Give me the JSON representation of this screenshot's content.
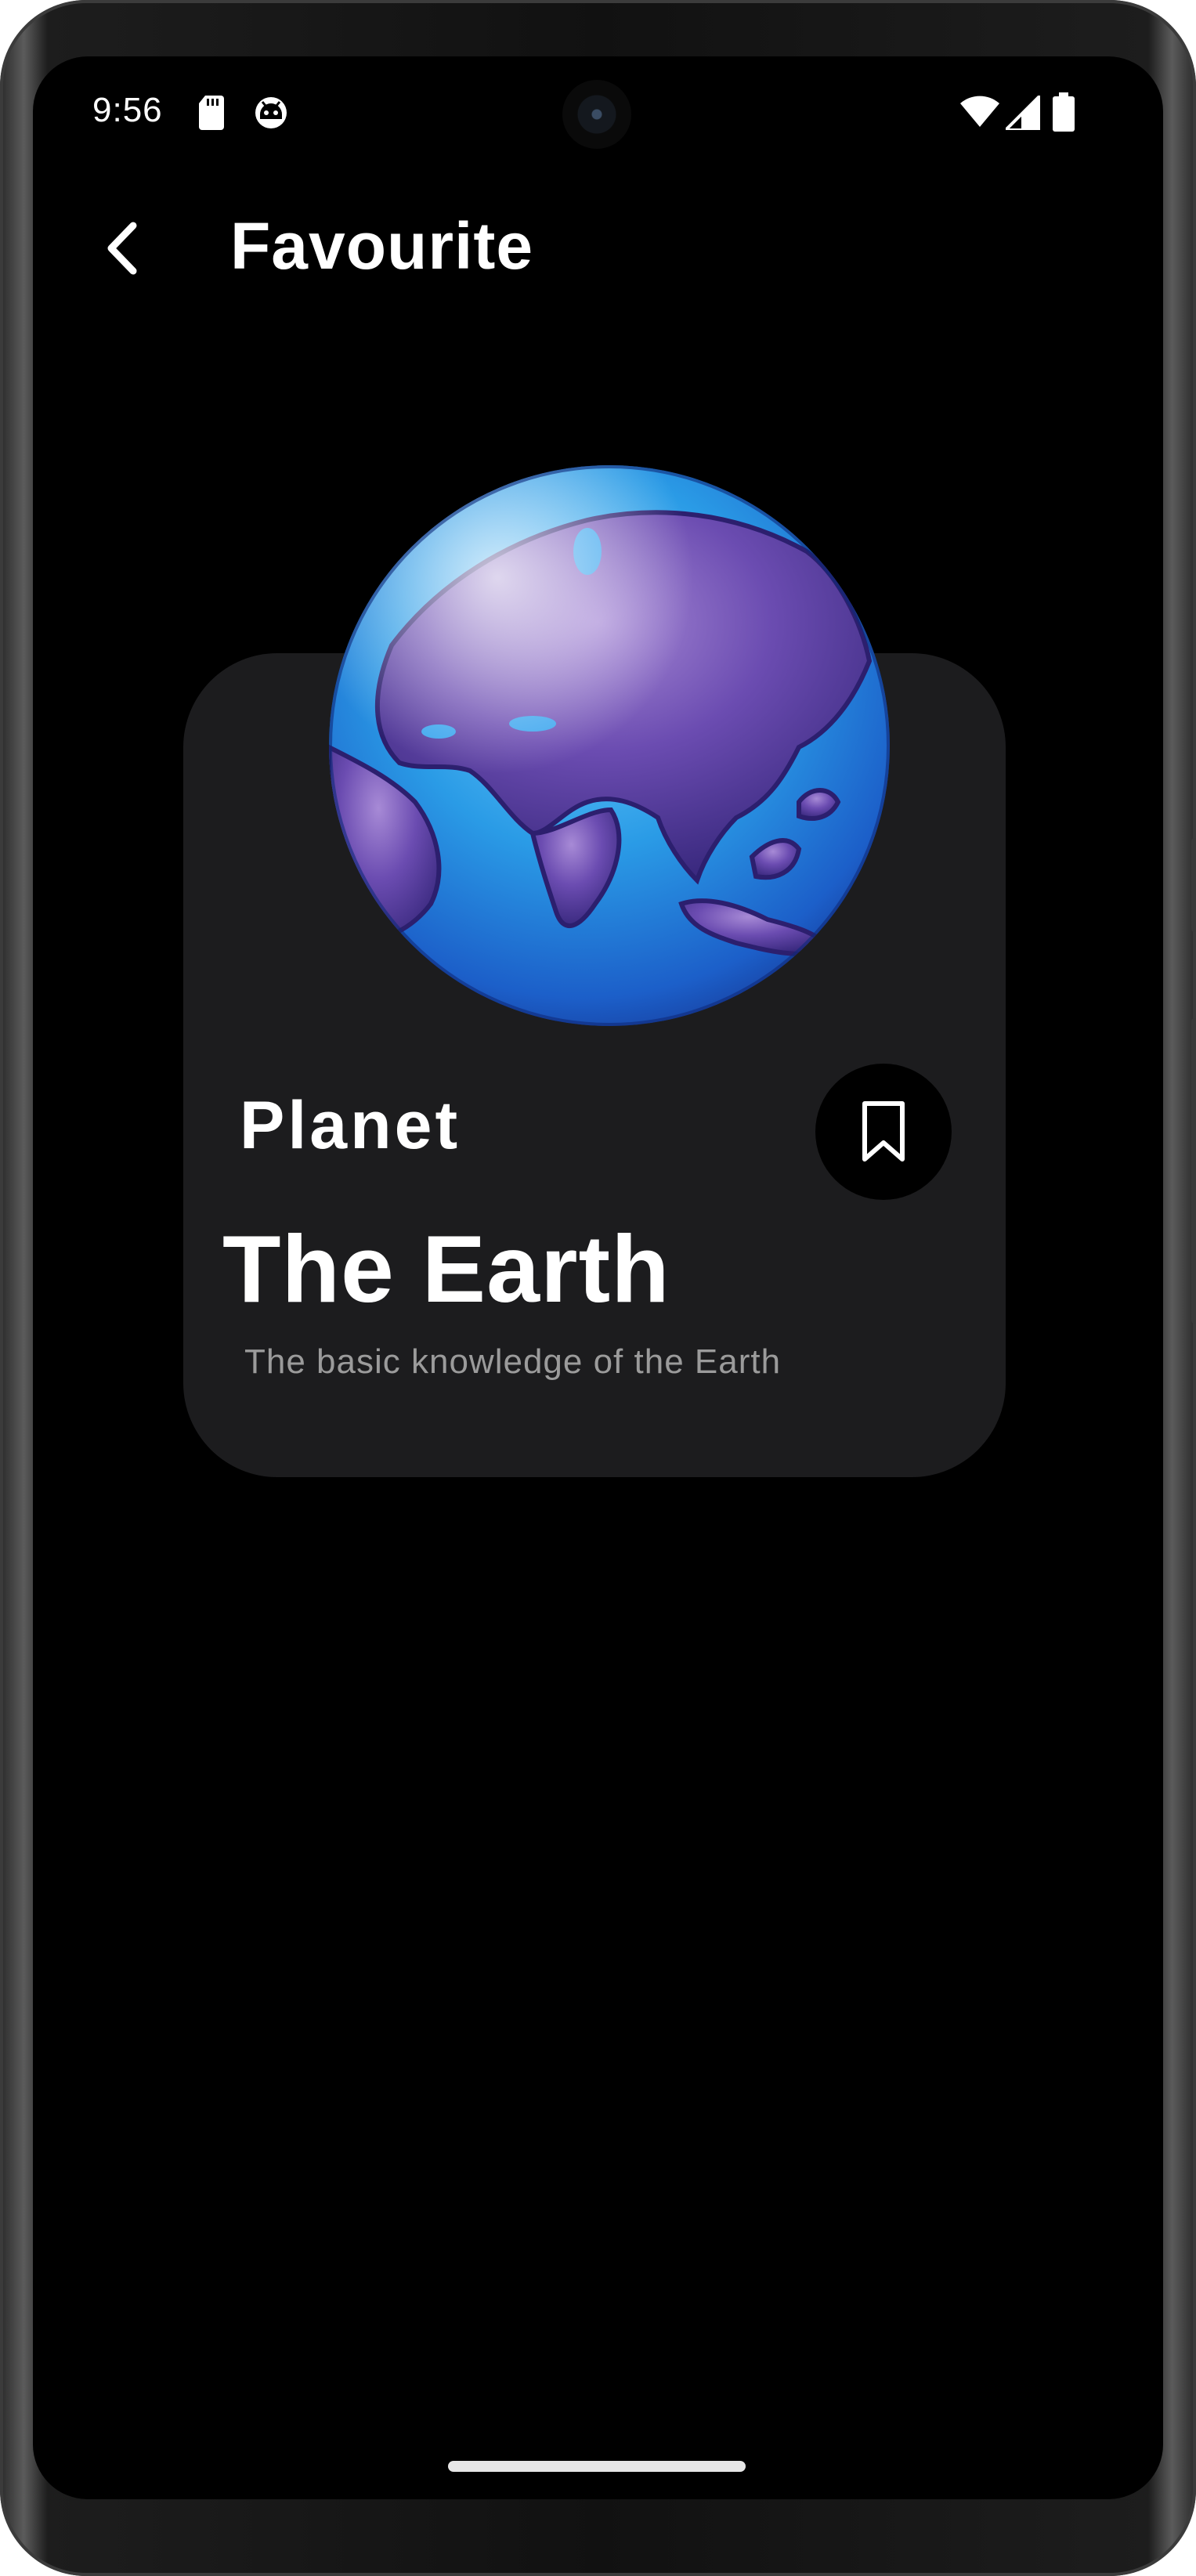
{
  "status_bar": {
    "time": "9:56",
    "icons": [
      "sd-card-icon",
      "android-debug-icon",
      "wifi-icon",
      "cell-signal-icon",
      "battery-icon"
    ]
  },
  "app_bar": {
    "back_icon": "chevron-left-icon",
    "title": "Favourite"
  },
  "card": {
    "image": "earth-globe",
    "category": "Planet",
    "title": "The Earth",
    "description": "The basic knowledge of the Earth",
    "bookmark_icon": "bookmark-outline-icon"
  },
  "colors": {
    "background": "#000000",
    "card": "#1c1c1e",
    "text": "#ffffff",
    "muted_text": "#9b9b9b"
  }
}
